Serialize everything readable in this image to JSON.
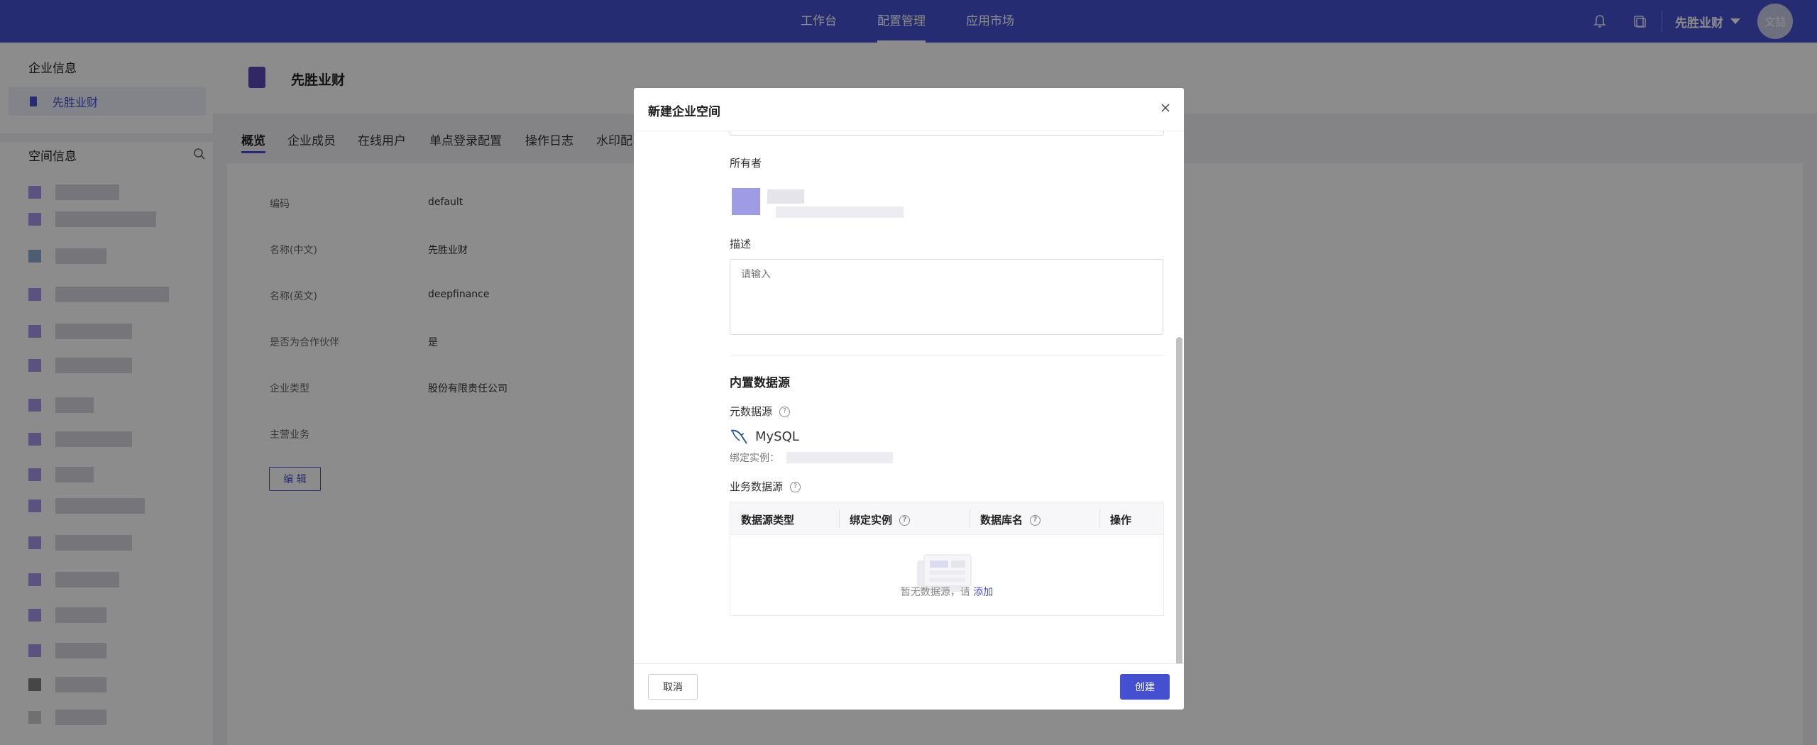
{
  "topbar": {
    "nav": [
      "工作台",
      "配置管理",
      "应用市场"
    ],
    "active_nav_index": 1,
    "company": "先胜业财",
    "avatar_text": "文喆",
    "colors": {
      "brand": "#4450d0"
    }
  },
  "sidebar": {
    "company_section_title": "企业信息",
    "company_item": "先胜业财",
    "space_section_title": "空间信息"
  },
  "main": {
    "company_name": "先胜业财",
    "tabs": [
      "概览",
      "企业成员",
      "在线用户",
      "单点登录配置",
      "操作日志",
      "水印配"
    ],
    "active_tab_index": 0,
    "info": [
      {
        "label": "编码",
        "value": "default"
      },
      {
        "label": "名称(中文)",
        "value": "先胜业财"
      },
      {
        "label": "名称(英文)",
        "value": "deepfinance"
      },
      {
        "label": "是否为合作伙伴",
        "value": "是"
      },
      {
        "label": "企业类型",
        "value": "股份有限责任公司"
      },
      {
        "label": "主营业务",
        "value": ""
      }
    ],
    "edit_button": "编 辑"
  },
  "modal": {
    "title": "新建企业空间",
    "owner_label": "所有者",
    "desc_label": "描述",
    "desc_placeholder": "请输入",
    "builtin_title": "内置数据源",
    "meta_source_label": "元数据源",
    "mysql_label": "MySQL",
    "bind_instance_label": "绑定实例：",
    "biz_source_label": "业务数据源",
    "table_headers": [
      "数据源类型",
      "绑定实例",
      "数据库名",
      "操作"
    ],
    "empty_text": "暂无数据源，请",
    "empty_link": "添加",
    "cancel_button": "取消",
    "create_button": "创建"
  }
}
